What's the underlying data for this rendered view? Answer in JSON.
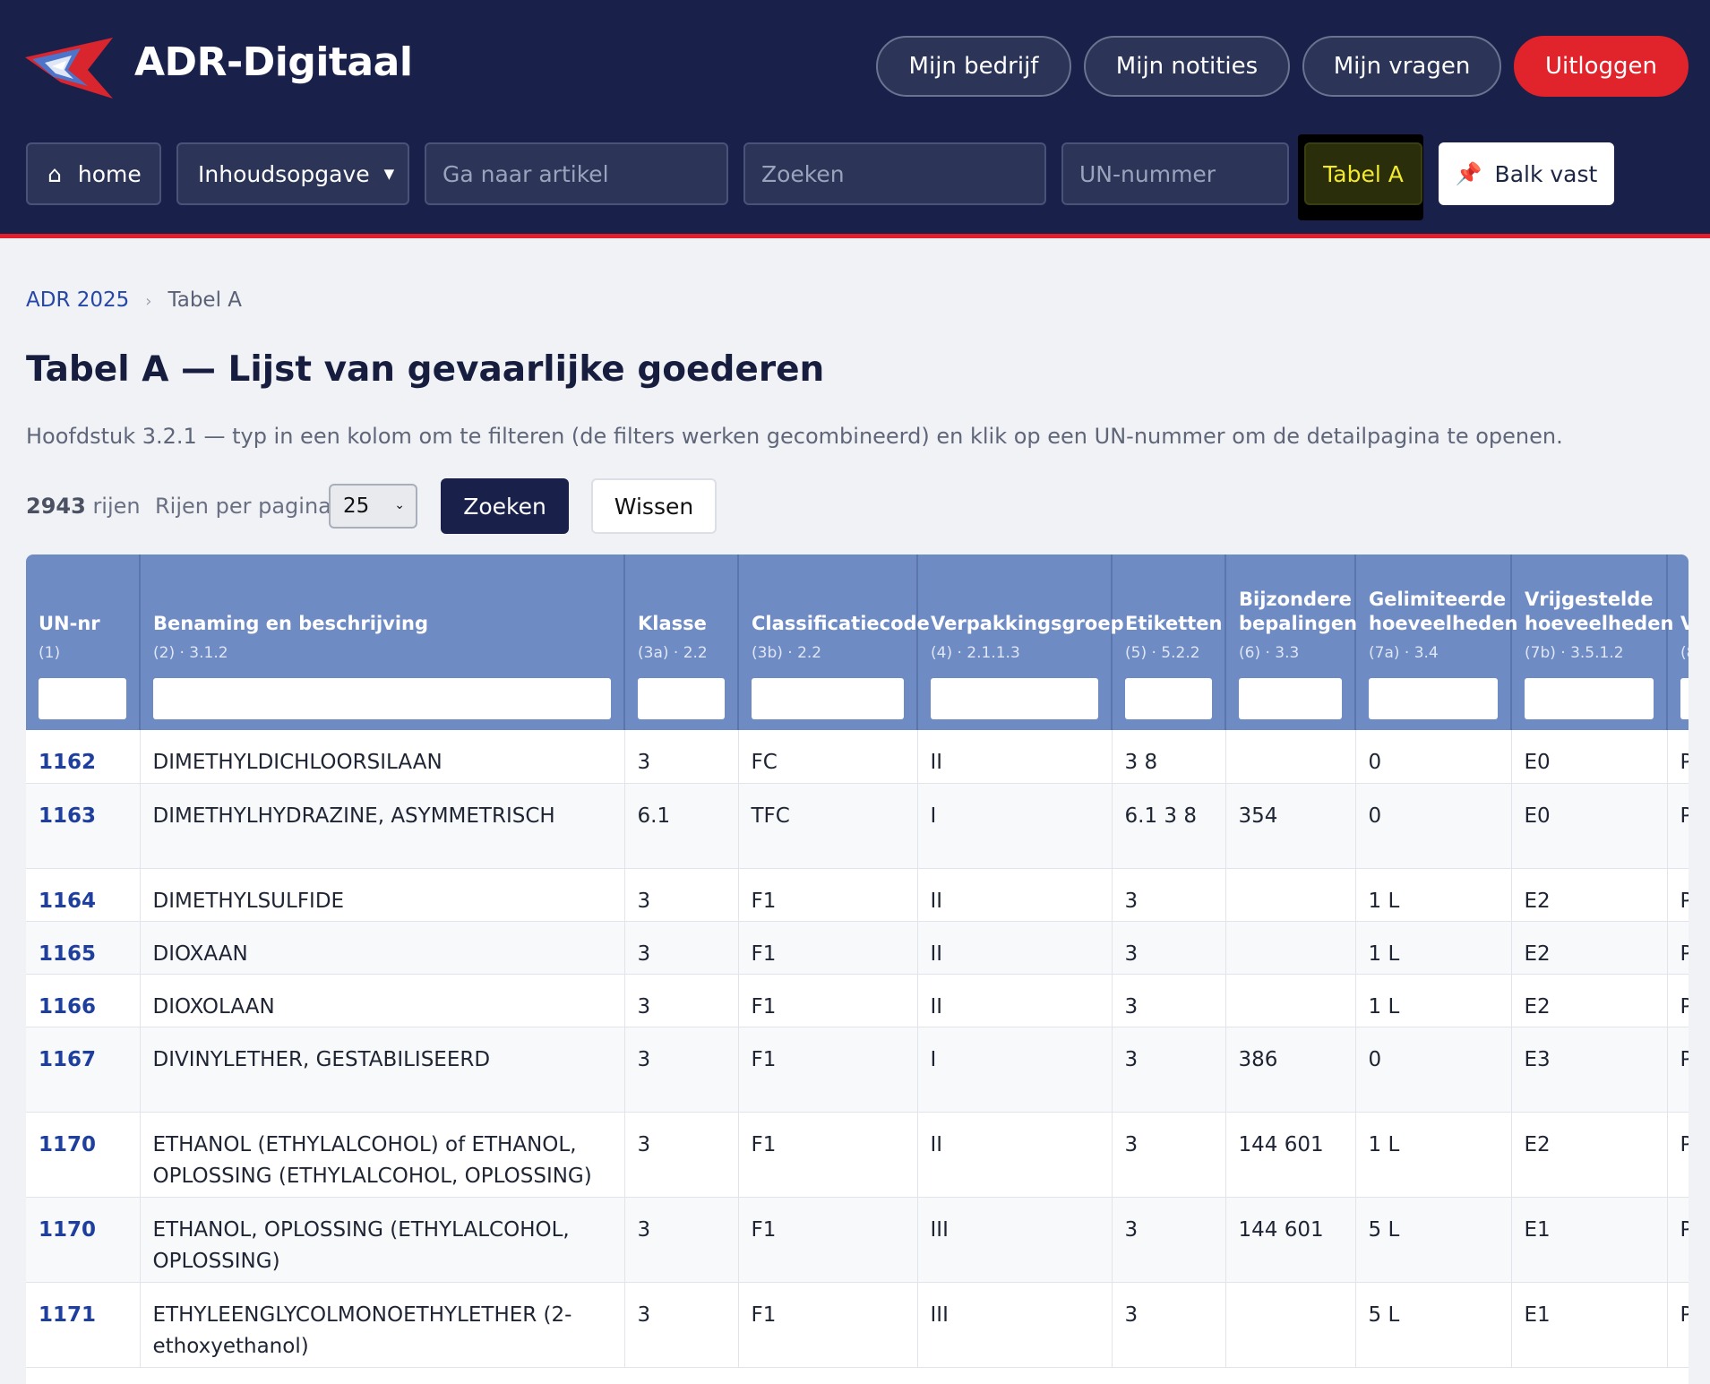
{
  "header": {
    "brand": "ADR-Digitaal",
    "buttons": {
      "company": "Mijn bedrijf",
      "notes": "Mijn notities",
      "questions": "Mijn vragen",
      "logout": "Uitloggen"
    },
    "nav": {
      "home_icon": "⌂",
      "home": "home",
      "contents": "Inhoudsopgave",
      "caret": "▼",
      "goto_placeholder": "Ga naar artikel",
      "search_placeholder": "Zoeken",
      "un_placeholder": "UN-nummer",
      "tabel_a": "Tabel A",
      "pin_icon": "📌",
      "pin_bar": "Balk vast"
    },
    "colors": {
      "navy": "#19204a",
      "red": "#e31e2c",
      "table_header": "#6f8bc4",
      "link": "#1f3f9e"
    }
  },
  "breadcrumb": {
    "root": "ADR 2025",
    "separator": "›",
    "current": "Tabel A"
  },
  "page": {
    "title": "Tabel A — Lijst van gevaarlijke goederen",
    "description": "Hoofdstuk 3.2.1 — typ in een kolom om te filteren (de filters werken gecombineerd) en klik op een UN-nummer om de detailpagina te openen."
  },
  "controls": {
    "row_count": "2943",
    "rows_label": "rijen",
    "per_page_label": "Rijen per pagina",
    "per_page_value": "25",
    "search_button": "Zoeken",
    "clear_button": "Wissen"
  },
  "table": {
    "columns": [
      {
        "name": "UN-nr",
        "ref": "(1)"
      },
      {
        "name": "Benaming en beschrijving",
        "ref": "(2) · 3.1.2"
      },
      {
        "name": "Klasse",
        "ref": "(3a) · 2.2"
      },
      {
        "name": "Classificatiecode",
        "ref": "(3b) · 2.2"
      },
      {
        "name": "Verpakkingsgroep",
        "ref": "(4) · 2.1.1.3"
      },
      {
        "name": "Etiketten",
        "ref": "(5) · 5.2.2"
      },
      {
        "name": "Bijzondere bepalingen",
        "ref": "(6) · 3.3"
      },
      {
        "name": "Gelimiteerde hoeveelheden",
        "ref": "(7a) · 3.4"
      },
      {
        "name": "Vrijgestelde hoeveelheden",
        "ref": "(7b) · 3.5.1.2"
      },
      {
        "name": "V",
        "ref": "(8"
      }
    ],
    "rows": [
      {
        "un": "1162",
        "name": "DIMETHYLDICHLOORSILAAN",
        "klasse": "3",
        "code": "FC",
        "vg": "II",
        "etiket": "3 8",
        "bep": "",
        "lq": "0",
        "eq": "E0",
        "next": "P"
      },
      {
        "un": "1163",
        "name": "DIMETHYLHYDRAZINE, ASYMMETRISCH",
        "klasse": "6.1",
        "code": "TFC",
        "vg": "I",
        "etiket": "6.1 3 8",
        "bep": "354",
        "lq": "0",
        "eq": "E0",
        "next": "P"
      },
      {
        "un": "1164",
        "name": "DIMETHYLSULFIDE",
        "klasse": "3",
        "code": "F1",
        "vg": "II",
        "etiket": "3",
        "bep": "",
        "lq": "1 L",
        "eq": "E2",
        "next": "P"
      },
      {
        "un": "1165",
        "name": "DIOXAAN",
        "klasse": "3",
        "code": "F1",
        "vg": "II",
        "etiket": "3",
        "bep": "",
        "lq": "1 L",
        "eq": "E2",
        "next": "P"
      },
      {
        "un": "1166",
        "name": "DIOXOLAAN",
        "klasse": "3",
        "code": "F1",
        "vg": "II",
        "etiket": "3",
        "bep": "",
        "lq": "1 L",
        "eq": "E2",
        "next": "P"
      },
      {
        "un": "1167",
        "name": "DIVINYLETHER, GESTABILISEERD",
        "klasse": "3",
        "code": "F1",
        "vg": "I",
        "etiket": "3",
        "bep": "386",
        "lq": "0",
        "eq": "E3",
        "next": "P"
      },
      {
        "un": "1170",
        "name": "ETHANOL (ETHYLALCOHOL) of ETHANOL, OPLOSSING (ETHYLALCOHOL, OPLOSSING)",
        "klasse": "3",
        "code": "F1",
        "vg": "II",
        "etiket": "3",
        "bep": "144 601",
        "lq": "1 L",
        "eq": "E2",
        "next": "P"
      },
      {
        "un": "1170",
        "name": "ETHANOL, OPLOSSING (ETHYLALCOHOL, OPLOSSING)",
        "klasse": "3",
        "code": "F1",
        "vg": "III",
        "etiket": "3",
        "bep": "144 601",
        "lq": "5 L",
        "eq": "E1",
        "next": "P"
      },
      {
        "un": "1171",
        "name": "ETHYLEENGLYCOLMONOETHYLETHER (2-ethoxyethanol)",
        "klasse": "3",
        "code": "F1",
        "vg": "III",
        "etiket": "3",
        "bep": "",
        "lq": "5 L",
        "eq": "E1",
        "next": "P"
      }
    ]
  }
}
